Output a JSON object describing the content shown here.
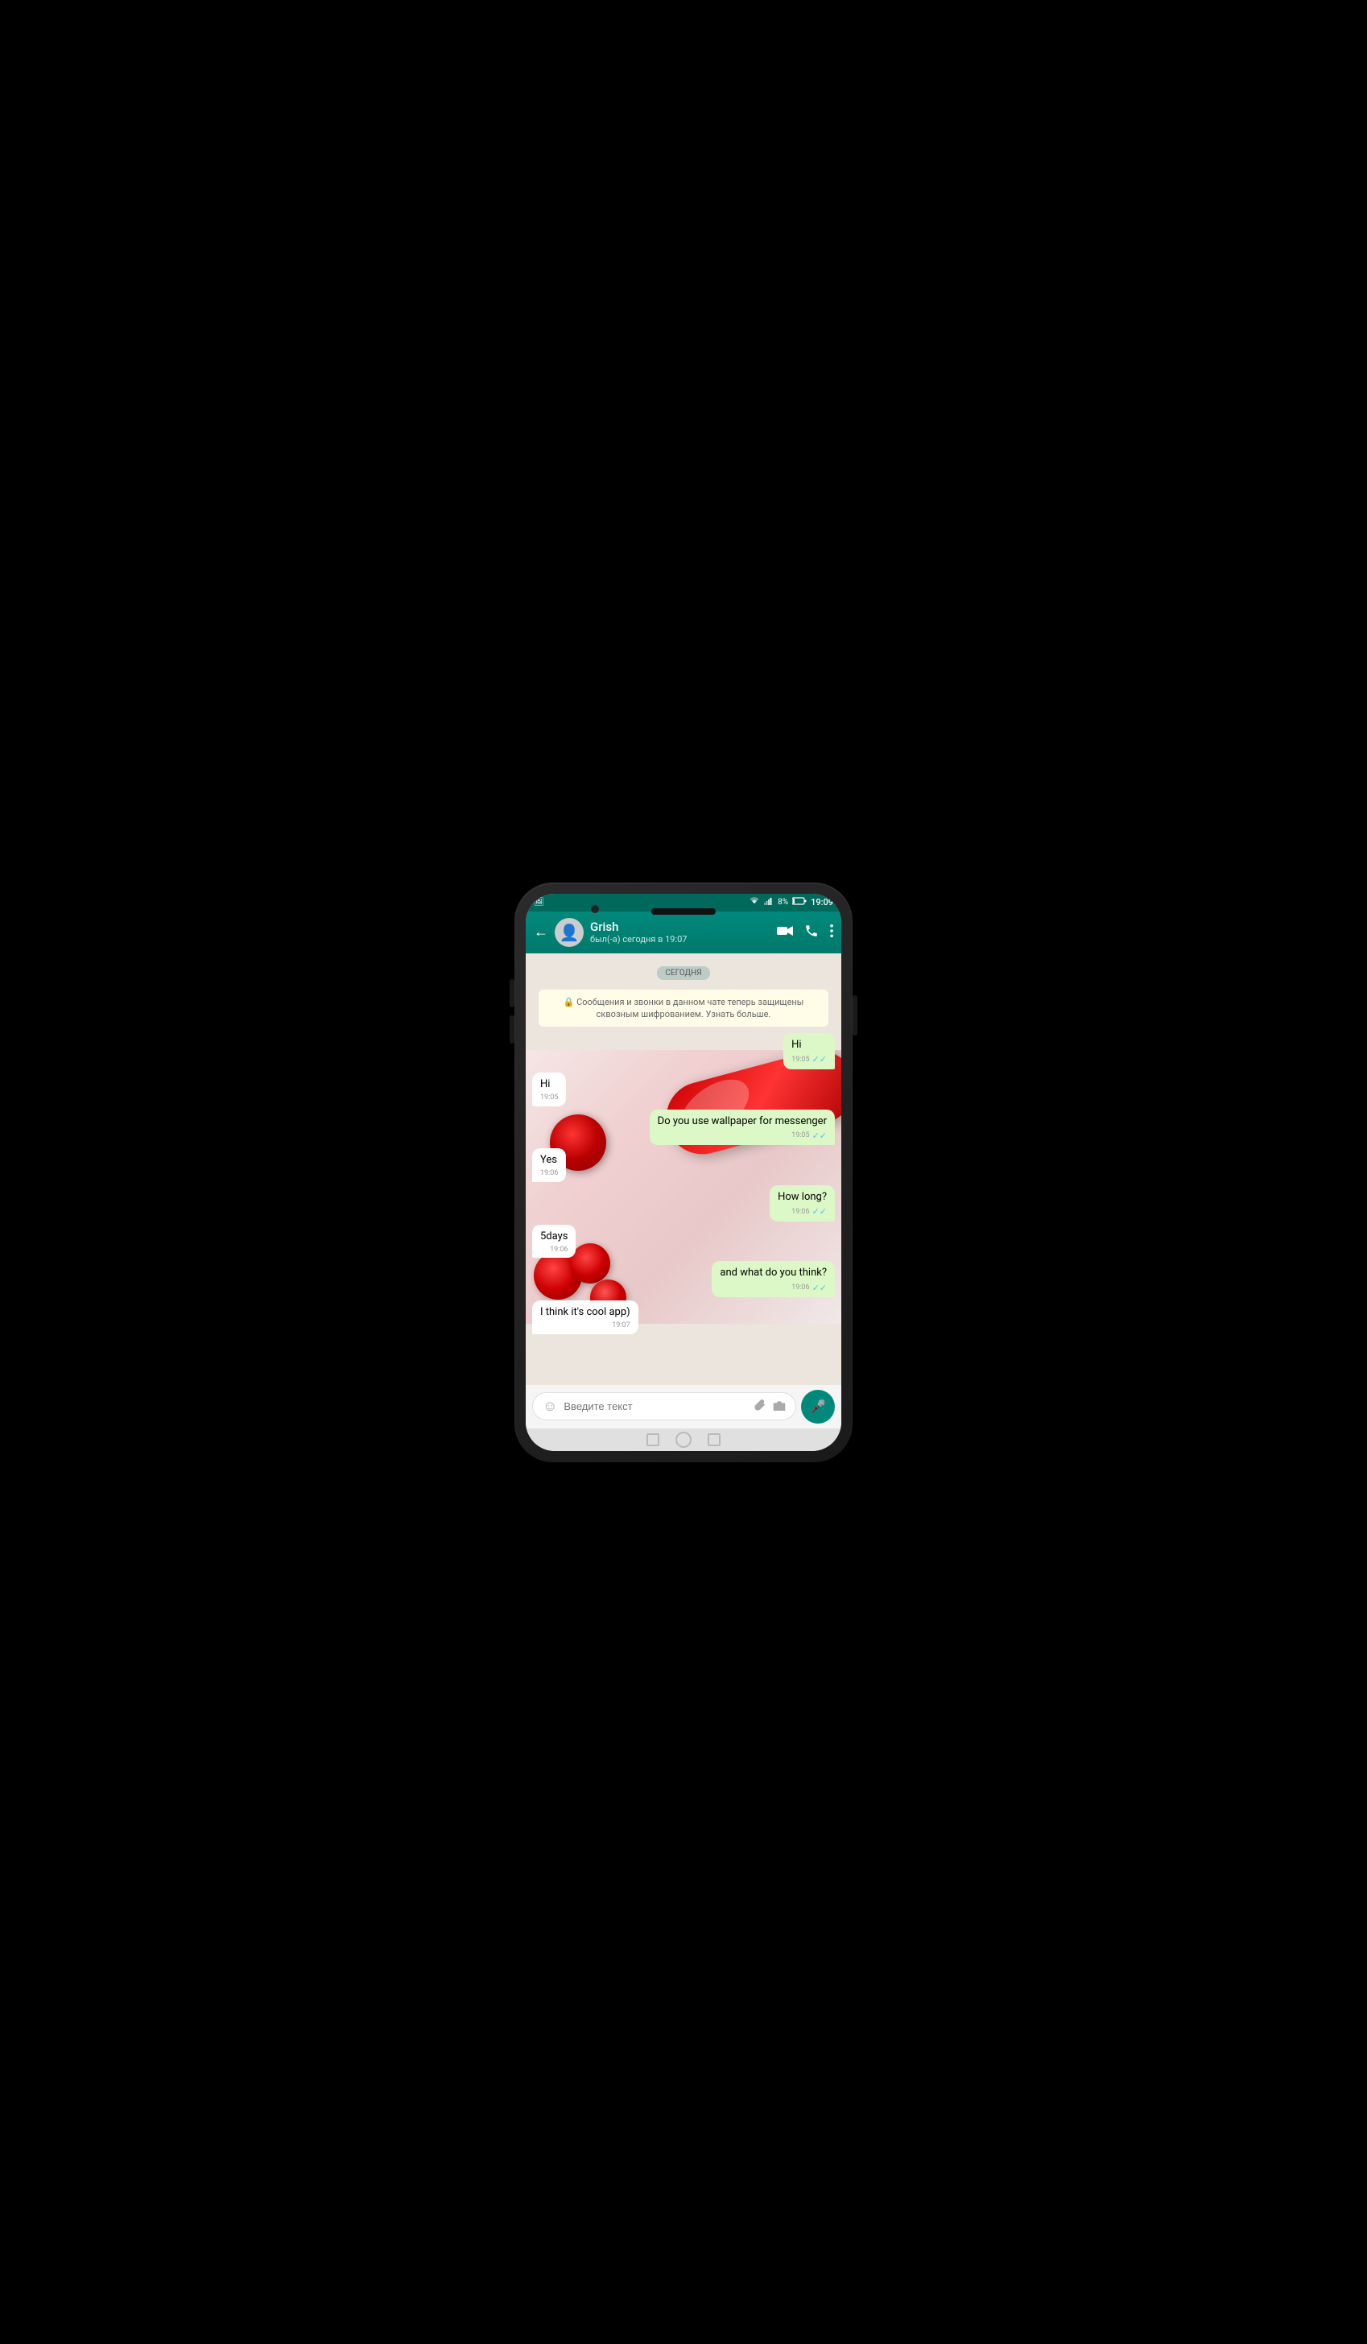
{
  "phone": {
    "status_bar": {
      "time": "19:09",
      "battery": "8%",
      "wifi_icon": "wifi",
      "signal_icon": "signal",
      "notification_icon": "📷"
    },
    "header": {
      "back_label": "←",
      "contact_name": "Grish",
      "contact_status": "был(-а) сегодня в 19:07",
      "video_icon": "video",
      "call_icon": "call",
      "more_icon": "more"
    },
    "date_divider": "СЕГОДНЯ",
    "encryption_notice": "🔒 Сообщения и звонки в данном чате теперь защищены сквозным шифрованием. Узнать больше.",
    "messages": [
      {
        "id": "msg1",
        "text": "Hi",
        "time": "19:05",
        "type": "sent",
        "ticks": "✓✓"
      },
      {
        "id": "msg2",
        "text": "Hi",
        "time": "19:05",
        "type": "received",
        "ticks": ""
      },
      {
        "id": "msg3",
        "text": "Do you use wallpaper for messenger",
        "time": "19:05",
        "type": "sent",
        "ticks": "✓✓"
      },
      {
        "id": "msg4",
        "text": "Yes",
        "time": "19:06",
        "type": "received",
        "ticks": ""
      },
      {
        "id": "msg5",
        "text": "How long?",
        "time": "19:06",
        "type": "sent",
        "ticks": "✓✓"
      },
      {
        "id": "msg6",
        "text": "5days",
        "time": "19:06",
        "type": "received",
        "ticks": ""
      },
      {
        "id": "msg7",
        "text": "and what do you think?",
        "time": "19:06",
        "type": "sent",
        "ticks": "✓✓"
      },
      {
        "id": "msg8",
        "text": "I think it's cool app)",
        "time": "19:07",
        "type": "received",
        "ticks": ""
      }
    ],
    "input": {
      "placeholder": "Введите текст"
    }
  }
}
